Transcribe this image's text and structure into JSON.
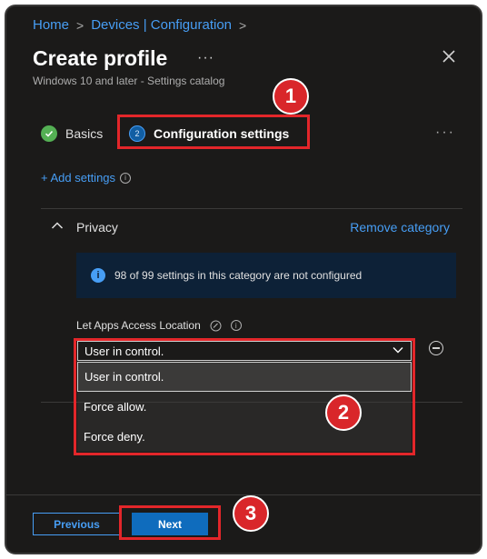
{
  "breadcrumb": {
    "home": "Home",
    "devices": "Devices | Configuration",
    "sep": ">"
  },
  "header": {
    "title": "Create profile",
    "more": "···",
    "subtitle": "Windows 10 and later - Settings catalog"
  },
  "steps": [
    {
      "label": "Basics",
      "status": "complete"
    },
    {
      "label": "Configuration settings",
      "number": "2",
      "status": "active"
    }
  ],
  "steps_more": "···",
  "add_settings": {
    "label": "+ Add settings",
    "info": "i"
  },
  "category": {
    "name": "Privacy",
    "remove_label": "Remove category"
  },
  "info_bar": {
    "icon": "i",
    "text": "98 of 99 settings in this category are not configured"
  },
  "setting": {
    "label": "Let Apps Access Location",
    "selected": "User in control.",
    "options": [
      "User in control.",
      "Force allow.",
      "Force deny."
    ]
  },
  "footer": {
    "previous_label": "Previous",
    "next_label": "Next"
  },
  "callouts": [
    "1",
    "2",
    "3"
  ],
  "colors": {
    "accent": "#479ef5",
    "callout": "#d9262a",
    "success": "#54b054",
    "primary_button": "#0f6cbd"
  }
}
